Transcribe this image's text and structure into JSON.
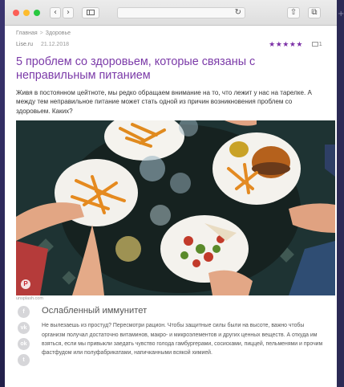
{
  "browser": {
    "back_icon": "‹",
    "forward_icon": "›",
    "reload_icon": "↻",
    "share_icon": "⇧",
    "tabs_icon": "⧉",
    "new_tab_icon": "+"
  },
  "breadcrumb": {
    "home": "Главная",
    "separator": ">",
    "section": "Здоровье"
  },
  "meta": {
    "source": "Lise.ru",
    "date": "21.12.2018",
    "rating_stars": "★★★★★",
    "rating": 5,
    "comments_count": "1"
  },
  "article": {
    "title": "5 проблем со здоровьем, которые связаны с неправильным питанием",
    "lead": "Живя в постоянном цейтноте, мы редко обращаем внимание на то, что лежит у нас на тарелке. А между тем неправильное питание может стать одной из причин возникновения проблем со здоровьем. Каких?",
    "photo_credit": "unsplash.com",
    "photo_pin_icon": "P"
  },
  "social": {
    "facebook": "f",
    "vk": "vk",
    "odnoklassniki": "ok",
    "twitter": "t"
  },
  "section1": {
    "heading": "Ослабленный иммунитет",
    "text": "Не вылезаешь из простуд? Пересмотри рацион. Чтобы защитные силы были на высоте, важно чтобы организм получал достаточно витаминов, макро- и микроэлементов и других ценных веществ. А откуда им взяться, если мы привыкли заедать чувство голода гамбургерами, сосисками, пиццей, пельменями и прочим фастфудом или полуфабрикатами, напичканными всякой химией."
  },
  "colors": {
    "accent": "#7b3aa8",
    "stars": "#7b2fa6",
    "background_dark": "#2a2650"
  }
}
